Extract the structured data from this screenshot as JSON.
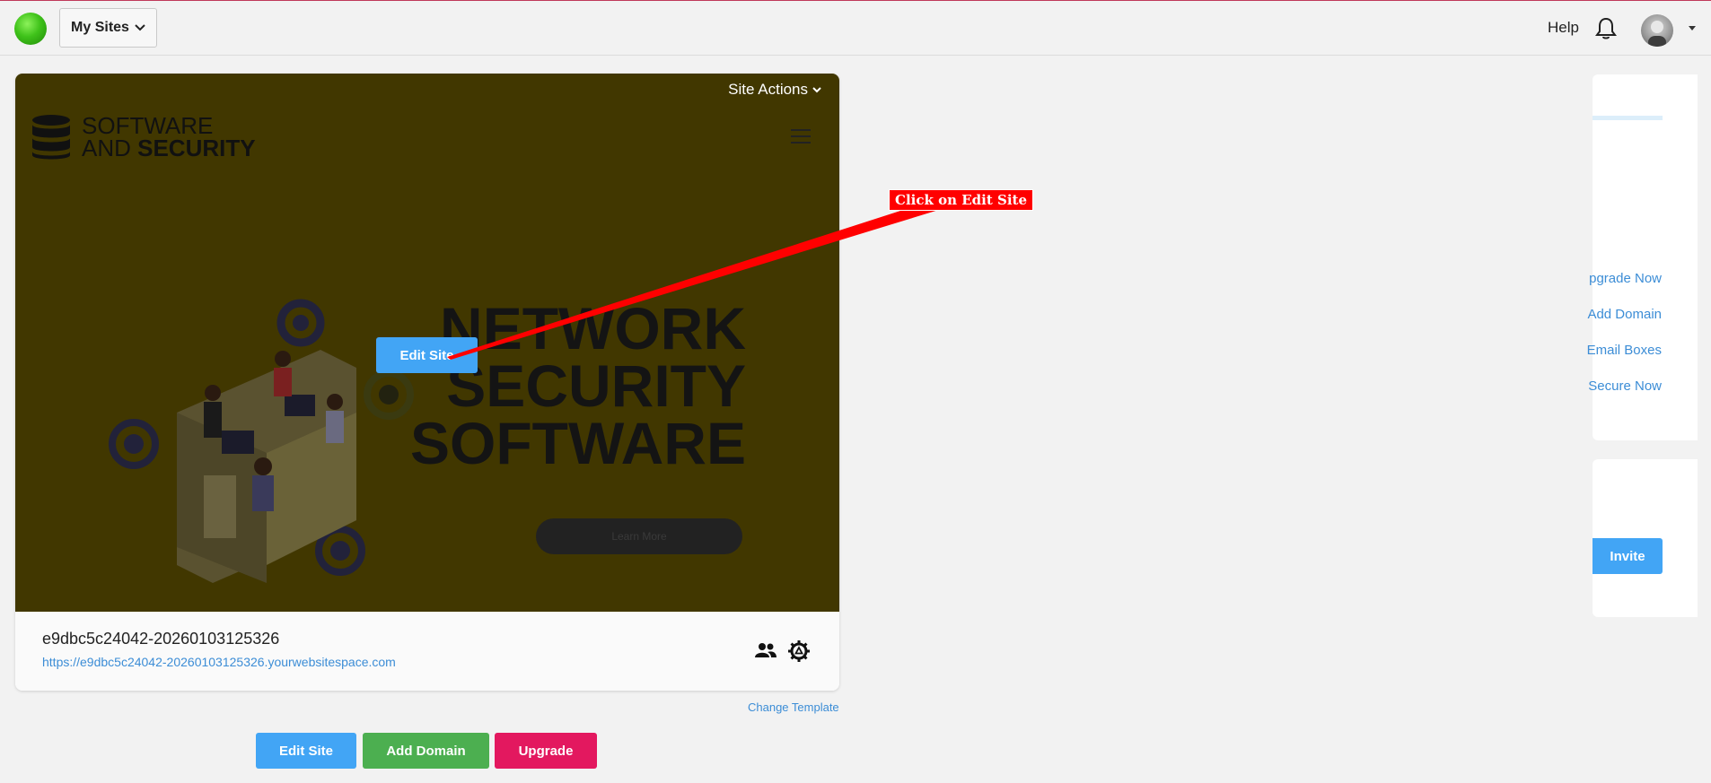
{
  "header": {
    "sites_menu_label": "My Sites",
    "help_label": "Help"
  },
  "site_card": {
    "actions_label": "Site Actions",
    "preview": {
      "brand_line1": "SOFTWARE",
      "brand_line2_a": "AND ",
      "brand_line2_b": "SECURITY",
      "headline": [
        "NETWORK",
        "SECURITY",
        "SOFTWARE"
      ],
      "learn_more_label": "Learn More",
      "edit_site_label": "Edit Site"
    },
    "site_name": "e9dbc5c24042-20260103125326",
    "site_url": "https://e9dbc5c24042-20260103125326.yourwebsitespace.com"
  },
  "change_template_label": "Change Template",
  "actions": {
    "edit_site": "Edit Site",
    "add_domain": "Add Domain",
    "upgrade": "Upgrade"
  },
  "callout": "Click on Edit Site",
  "right_panel": {
    "links": [
      "pgrade Now",
      "Add Domain",
      "Email Boxes",
      "Secure Now"
    ],
    "invite_label": "Invite"
  },
  "colors": {
    "primary_blue": "#42a5f5",
    "green": "#4caf50",
    "pink": "#e3185f",
    "preview_overlay": "#413700",
    "callout_red": "#ff0000"
  }
}
